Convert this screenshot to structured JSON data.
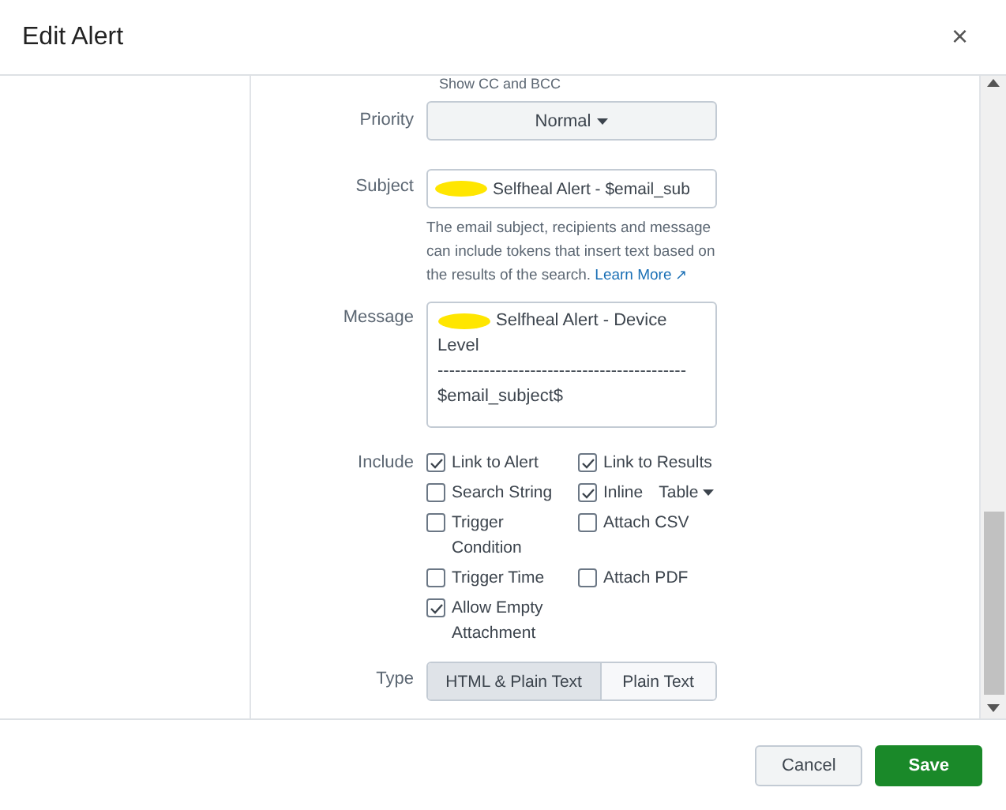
{
  "dialog": {
    "title": "Edit Alert",
    "close": "×"
  },
  "form": {
    "cut_hint": "Show CC and BCC",
    "priority": {
      "label": "Priority",
      "value": "Normal"
    },
    "subject": {
      "label": "Subject",
      "value": "Selfheal Alert -  $email_sub",
      "redacted": true,
      "help": "The email subject, recipients and message can include tokens that insert text based on the results of the search.",
      "link": "Learn More",
      "link_icon": "↗"
    },
    "message": {
      "label": "Message",
      "lines": [
        "Selfheal Alert - Device",
        "Level",
        "-------------------------------------------",
        "$email_subject$"
      ],
      "redacted": true
    },
    "include": {
      "label": "Include",
      "options": [
        {
          "kind": "check",
          "label": "Link to Alert",
          "checked": true
        },
        {
          "kind": "check",
          "label": "Link to Results",
          "checked": true
        },
        {
          "kind": "check",
          "label": "Search String",
          "checked": false
        },
        {
          "kind": "inline",
          "label": "Inline",
          "checked": true,
          "format": "Table"
        },
        {
          "kind": "check",
          "label": "Trigger Condition",
          "checked": false
        },
        {
          "kind": "check",
          "label": "Attach CSV",
          "checked": false
        },
        {
          "kind": "check",
          "label": "Trigger Time",
          "checked": false
        },
        {
          "kind": "check",
          "label": "Attach PDF",
          "checked": false
        },
        {
          "kind": "check",
          "label": "Allow Empty Attachment",
          "checked": true
        }
      ]
    },
    "type": {
      "label": "Type",
      "options": [
        {
          "label": "HTML & Plain Text",
          "selected": true
        },
        {
          "label": "Plain Text",
          "selected": false
        }
      ]
    }
  },
  "buttons": [
    {
      "kind": "secondary",
      "label": "Cancel"
    },
    {
      "kind": "primary",
      "label": "Save"
    }
  ]
}
